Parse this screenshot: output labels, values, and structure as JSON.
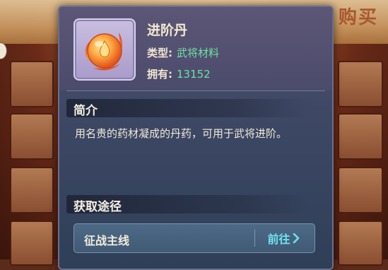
{
  "background": {
    "buy_text": "购买"
  },
  "item": {
    "name": "进阶丹",
    "type_label": "类型:",
    "type_value": "武将材料",
    "owned_label": "拥有:",
    "owned_value": "13152",
    "icon": "fire-orb-icon"
  },
  "intro": {
    "heading": "简介",
    "text": "用名贵的药材凝成的丹药，可用于武将进阶。"
  },
  "source": {
    "heading": "获取途径",
    "routes": [
      {
        "name": "征战主线",
        "action": "前往"
      }
    ]
  },
  "colors": {
    "accent_green": "#6ee3a0",
    "accent_cyan": "#6ee3f0",
    "panel_top": "#5d5676",
    "panel_bottom": "#2f3f58"
  }
}
